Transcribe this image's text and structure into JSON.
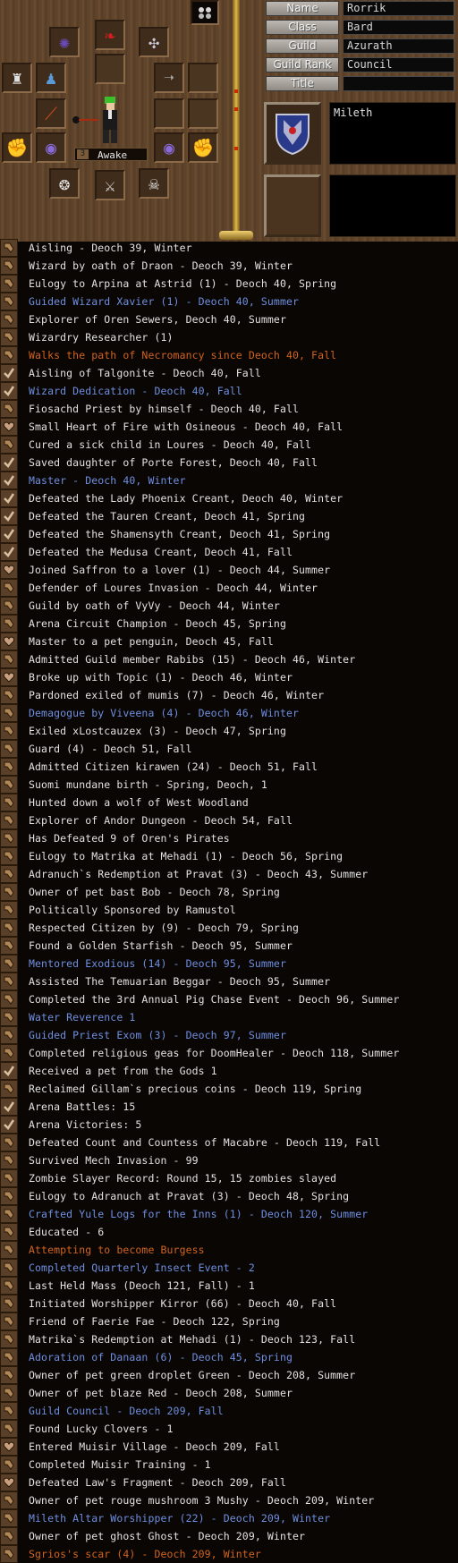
{
  "equipment": {
    "status_number": "3",
    "status_label": "Awake"
  },
  "profile_fields": [
    {
      "label": "Name",
      "value": "Rorrik"
    },
    {
      "label": "Class",
      "value": "Bard"
    },
    {
      "label": "Guild",
      "value": "Azurath"
    },
    {
      "label": "Guild Rank",
      "value": "Council"
    },
    {
      "label": "Title",
      "value": ""
    }
  ],
  "nation": "Mileth",
  "colors": {
    "normal": "#e2e2e2",
    "blue": "#6f8fe0",
    "orange": "#d2641e"
  },
  "legend": [
    {
      "icon": "tool-icon",
      "text": "Aisling - Deoch 39, Winter",
      "color": "normal"
    },
    {
      "icon": "tool-icon",
      "text": "Wizard by oath of Draon - Deoch 39, Winter",
      "color": "normal"
    },
    {
      "icon": "tool-icon",
      "text": "Eulogy to Arpina at Astrid (1) - Deoch 40, Spring",
      "color": "normal"
    },
    {
      "icon": "tool-icon",
      "text": "Guided Wizard Xavier (1) - Deoch 40, Summer",
      "color": "blue"
    },
    {
      "icon": "tool-icon",
      "text": "Explorer of Oren Sewers, Deoch 40, Summer",
      "color": "normal"
    },
    {
      "icon": "tool-icon",
      "text": "Wizardry Researcher (1)",
      "color": "normal"
    },
    {
      "icon": "tool-icon",
      "text": "Walks the path of Necromancy since Deoch 40, Fall",
      "color": "orange"
    },
    {
      "icon": "check-icon",
      "text": "Aisling of Talgonite - Deoch 40, Fall",
      "color": "normal"
    },
    {
      "icon": "check-icon",
      "text": "Wizard Dedication - Deoch 40, Fall",
      "color": "blue"
    },
    {
      "icon": "tool-icon",
      "text": "Fiosachd Priest by himself - Deoch 40, Fall",
      "color": "normal"
    },
    {
      "icon": "heart-icon",
      "text": "Small Heart of Fire with Osineous - Deoch 40, Fall",
      "color": "normal"
    },
    {
      "icon": "tool-icon",
      "text": "Cured a sick child in Loures - Deoch 40, Fall",
      "color": "normal"
    },
    {
      "icon": "check-icon",
      "text": "Saved daughter of Porte Forest, Deoch 40, Fall",
      "color": "normal"
    },
    {
      "icon": "check-icon",
      "text": "Master - Deoch 40, Winter",
      "color": "blue"
    },
    {
      "icon": "check-icon",
      "text": "Defeated the Lady Phoenix Creant, Deoch 40, Winter",
      "color": "normal"
    },
    {
      "icon": "check-icon",
      "text": "Defeated the Tauren Creant, Deoch 41, Spring",
      "color": "normal"
    },
    {
      "icon": "check-icon",
      "text": "Defeated the Shamensyth Creant, Deoch 41, Spring",
      "color": "normal"
    },
    {
      "icon": "check-icon",
      "text": "Defeated the Medusa Creant, Deoch 41, Fall",
      "color": "normal"
    },
    {
      "icon": "heart-icon",
      "text": "Joined Saffron to a lover (1) - Deoch 44, Summer",
      "color": "normal"
    },
    {
      "icon": "tool-icon",
      "text": "Defender of Loures Invasion - Deoch 44, Winter",
      "color": "normal"
    },
    {
      "icon": "tool-icon",
      "text": "Guild by oath of VyVy - Deoch 44, Winter",
      "color": "normal"
    },
    {
      "icon": "tool-icon",
      "text": "Arena Circuit Champion - Deoch 45, Spring",
      "color": "normal"
    },
    {
      "icon": "heart-icon",
      "text": "Master to a pet penguin, Deoch 45, Fall",
      "color": "normal"
    },
    {
      "icon": "tool-icon",
      "text": "Admitted Guild member Rabibs (15) - Deoch 46, Winter",
      "color": "normal"
    },
    {
      "icon": "heart-icon",
      "text": "Broke up with Topic (1) - Deoch 46, Winter",
      "color": "normal"
    },
    {
      "icon": "tool-icon",
      "text": "Pardoned exiled of mumis (7) - Deoch 46, Winter",
      "color": "normal"
    },
    {
      "icon": "tool-icon",
      "text": "Demagogue by Viveena (4) - Deoch 46, Winter",
      "color": "blue"
    },
    {
      "icon": "tool-icon",
      "text": "Exiled xLostcauzex (3) - Deoch 47, Spring",
      "color": "normal"
    },
    {
      "icon": "tool-icon",
      "text": "Guard (4) - Deoch 51, Fall",
      "color": "normal"
    },
    {
      "icon": "tool-icon",
      "text": "Admitted Citizen kirawen (24) - Deoch 51, Fall",
      "color": "normal"
    },
    {
      "icon": "tool-icon",
      "text": "Suomi mundane birth - Spring, Deoch, 1",
      "color": "normal"
    },
    {
      "icon": "tool-icon",
      "text": "Hunted down a wolf of West Woodland",
      "color": "normal"
    },
    {
      "icon": "tool-icon",
      "text": "Explorer of Andor Dungeon - Deoch 54, Fall",
      "color": "normal"
    },
    {
      "icon": "tool-icon",
      "text": "Has Defeated 9 of Oren's Pirates",
      "color": "normal"
    },
    {
      "icon": "tool-icon",
      "text": "Eulogy to Matrika at Mehadi (1) - Deoch 56, Spring",
      "color": "normal"
    },
    {
      "icon": "tool-icon",
      "text": "Adranuch`s Redemption at Pravat (3) - Deoch 43, Summer",
      "color": "normal"
    },
    {
      "icon": "tool-icon",
      "text": "Owner of pet bast Bob - Deoch 78, Spring",
      "color": "normal"
    },
    {
      "icon": "tool-icon",
      "text": "Politically Sponsored by Ramustol",
      "color": "normal"
    },
    {
      "icon": "tool-icon",
      "text": "Respected Citizen by  (9) - Deoch 79, Spring",
      "color": "normal"
    },
    {
      "icon": "tool-icon",
      "text": "Found a Golden Starfish - Deoch 95, Summer",
      "color": "normal"
    },
    {
      "icon": "tool-icon",
      "text": "Mentored Exodious (14) - Deoch 95, Summer",
      "color": "blue"
    },
    {
      "icon": "tool-icon",
      "text": "Assisted The Temuarian Beggar - Deoch 95, Summer",
      "color": "normal"
    },
    {
      "icon": "tool-icon",
      "text": "Completed the 3rd Annual Pig Chase Event - Deoch 96, Summer",
      "color": "normal"
    },
    {
      "icon": "tool-icon",
      "text": "Water Reverence 1",
      "color": "blue"
    },
    {
      "icon": "tool-icon",
      "text": "Guided Priest Exom (3) - Deoch 97, Summer",
      "color": "blue"
    },
    {
      "icon": "tool-icon",
      "text": "Completed religious geas for DoomHealer - Deoch 118, Summer",
      "color": "normal"
    },
    {
      "icon": "check-icon",
      "text": "Received a pet from the Gods 1",
      "color": "normal"
    },
    {
      "icon": "tool-icon",
      "text": "Reclaimed Gillam`s precious coins - Deoch 119, Spring",
      "color": "normal"
    },
    {
      "icon": "check-icon",
      "text": "Arena Battles: 15",
      "color": "normal"
    },
    {
      "icon": "check-icon",
      "text": "Arena Victories: 5",
      "color": "normal"
    },
    {
      "icon": "tool-icon",
      "text": "Defeated Count and Countess of Macabre - Deoch 119, Fall",
      "color": "normal"
    },
    {
      "icon": "tool-icon",
      "text": "Survived Mech Invasion - 99",
      "color": "normal"
    },
    {
      "icon": "tool-icon",
      "text": "Zombie Slayer Record: Round 15, 15 zombies slayed",
      "color": "normal"
    },
    {
      "icon": "tool-icon",
      "text": "Eulogy to Adranuch at Pravat (3) - Deoch 48, Spring",
      "color": "normal"
    },
    {
      "icon": "tool-icon",
      "text": "Crafted Yule Logs for the Inns (1) - Deoch 120, Summer",
      "color": "blue"
    },
    {
      "icon": "tool-icon",
      "text": "Educated - 6",
      "color": "normal"
    },
    {
      "icon": "tool-icon",
      "text": "Attempting to become Burgess",
      "color": "orange"
    },
    {
      "icon": "tool-icon",
      "text": "Completed Quarterly Insect Event - 2",
      "color": "blue"
    },
    {
      "icon": "tool-icon",
      "text": "Last Held Mass (Deoch 121, Fall) - 1",
      "color": "normal"
    },
    {
      "icon": "tool-icon",
      "text": "Initiated Worshipper Kirror (66) - Deoch 40, Fall",
      "color": "normal"
    },
    {
      "icon": "tool-icon",
      "text": "Friend of Faerie Fae - Deoch 122, Spring",
      "color": "normal"
    },
    {
      "icon": "tool-icon",
      "text": "Matrika`s Redemption at Mehadi (1) - Deoch 123, Fall",
      "color": "normal"
    },
    {
      "icon": "tool-icon",
      "text": "Adoration of Danaan (6) - Deoch 45, Spring",
      "color": "blue"
    },
    {
      "icon": "tool-icon",
      "text": "Owner of pet green droplet Green - Deoch 208, Summer",
      "color": "normal"
    },
    {
      "icon": "tool-icon",
      "text": "Owner of pet blaze Red - Deoch 208, Summer",
      "color": "normal"
    },
    {
      "icon": "tool-icon",
      "text": "Guild Council - Deoch 209, Fall",
      "color": "blue"
    },
    {
      "icon": "tool-icon",
      "text": "Found Lucky Clovers - 1",
      "color": "normal"
    },
    {
      "icon": "heart-icon",
      "text": "Entered Muisir Village - Deoch 209, Fall",
      "color": "normal"
    },
    {
      "icon": "tool-icon",
      "text": "Completed Muisir Training - 1",
      "color": "normal"
    },
    {
      "icon": "heart-icon",
      "text": "Defeated Law's Fragment - Deoch 209, Fall",
      "color": "normal"
    },
    {
      "icon": "tool-icon",
      "text": "Owner of pet rouge mushroom 3 Mushy - Deoch 209, Winter",
      "color": "normal"
    },
    {
      "icon": "tool-icon",
      "text": "Mileth Altar Worshipper (22) - Deoch 209, Winter",
      "color": "blue"
    },
    {
      "icon": "tool-icon",
      "text": "Owner of pet ghost Ghost - Deoch 209, Winter",
      "color": "normal"
    },
    {
      "icon": "tool-icon",
      "text": "Sgrios's scar (4) - Deoch 209, Winter",
      "color": "orange"
    }
  ]
}
